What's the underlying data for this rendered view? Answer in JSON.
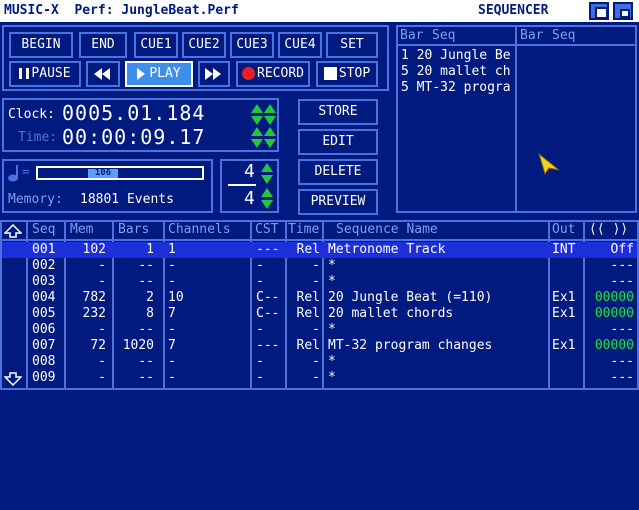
{
  "titlebar": {
    "title": "MUSIC-X  Perf: JungleBeat.Perf",
    "screen": "SEQUENCER"
  },
  "transport": {
    "row1": [
      "BEGIN",
      "END",
      "CUE1",
      "CUE2",
      "CUE3",
      "CUE4",
      "SET"
    ],
    "pause": "PAUSE",
    "play": "PLAY",
    "record": "RECORD",
    "stop": "STOP"
  },
  "clock": {
    "clock_label": "Clock:",
    "clock_value": "0005.01.184",
    "time_label": "Time:",
    "time_value": "00:00:09.17"
  },
  "tempo": {
    "icon": "note-icon",
    "value": "106"
  },
  "memory": {
    "label": "Memory:",
    "value": "18801 Events"
  },
  "timesig": {
    "numerator": "4",
    "denominator": "4"
  },
  "actions": [
    "STORE",
    "EDIT",
    "DELETE",
    "PREVIEW"
  ],
  "barseq": {
    "headers": [
      "Bar",
      "Seq",
      "Bar",
      "Seq"
    ],
    "lines": [
      "1 20 Jungle Be",
      "5 20 mallet ch",
      "5 MT-32 progra"
    ]
  },
  "table": {
    "columns": [
      "Seq",
      "Mem",
      "Bars",
      "Channels",
      "CST",
      "Time",
      "Sequence Name",
      "Out",
      "⟨⟨ ⟩⟩"
    ],
    "rows": [
      {
        "seq": "001",
        "mem": "102",
        "bars": "1",
        "ch": "1",
        "cst": "---",
        "time": "Rel",
        "name": "Metronome Track",
        "out": "INT",
        "off": "Off",
        "selected": true
      },
      {
        "seq": "002",
        "mem": "-",
        "bars": "--",
        "ch": "-",
        "cst": "-",
        "time": "-",
        "name": "*",
        "out": "",
        "off": "---"
      },
      {
        "seq": "003",
        "mem": "-",
        "bars": "--",
        "ch": "-",
        "cst": "-",
        "time": "-",
        "name": "*",
        "out": "",
        "off": "---"
      },
      {
        "seq": "004",
        "mem": "782",
        "bars": "2",
        "ch": "10",
        "cst": "C--",
        "time": "Rel",
        "name": "20 Jungle Beat (=110)",
        "out": "Ex1",
        "off": "00000",
        "green": true
      },
      {
        "seq": "005",
        "mem": "232",
        "bars": "8",
        "ch": "7",
        "cst": "C--",
        "time": "Rel",
        "name": "20 mallet chords",
        "out": "Ex1",
        "off": "00000",
        "green": true
      },
      {
        "seq": "006",
        "mem": "-",
        "bars": "--",
        "ch": "-",
        "cst": "-",
        "time": "-",
        "name": "*",
        "out": "",
        "off": "---"
      },
      {
        "seq": "007",
        "mem": "72",
        "bars": "1020",
        "ch": "7",
        "cst": "---",
        "time": "Rel",
        "name": "MT-32 program changes",
        "out": "Ex1",
        "off": "00000",
        "green": true
      },
      {
        "seq": "008",
        "mem": "-",
        "bars": "--",
        "ch": "-",
        "cst": "-",
        "time": "-",
        "name": "*",
        "out": "",
        "off": "---"
      },
      {
        "seq": "009",
        "mem": "-",
        "bars": "--",
        "ch": "-",
        "cst": "-",
        "time": "-",
        "name": "*",
        "out": "",
        "off": "---"
      }
    ]
  },
  "colors": {
    "background": "#001a80",
    "border": "#4a72e0",
    "accent": "#3e8eea",
    "green": "#20c840",
    "record": "#e8202a",
    "pointer": "#f0d020"
  }
}
